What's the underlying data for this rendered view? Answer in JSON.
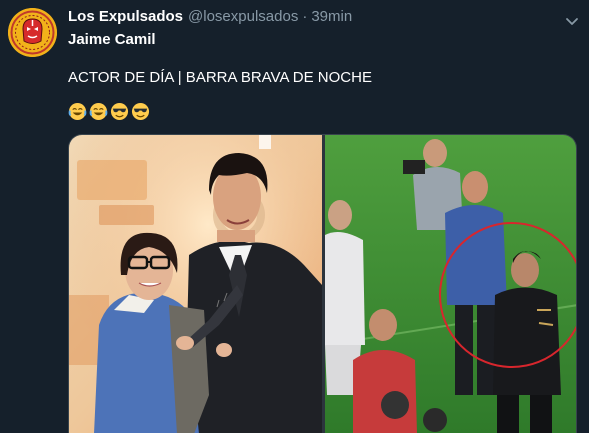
{
  "tweet": {
    "display_name": "Los Expulsados",
    "handle": "@losexpulsados",
    "separator": "·",
    "time": "39min",
    "line1": "Jaime Camil",
    "line2": "ACTOR DE DÍA | BARRA BRAVA DE NOCHE",
    "emojis": [
      "joy-emoji",
      "joy-emoji",
      "sunglasses-emoji",
      "sunglasses-emoji"
    ]
  },
  "icons": {
    "avatar": "luchador-mask-avatar",
    "caret": "chevron-down-icon"
  },
  "colors": {
    "background": "#15202b",
    "text": "#ffffff",
    "secondary": "#8899a6",
    "border": "#38444d",
    "avatar_bg": "#f2b21a"
  }
}
